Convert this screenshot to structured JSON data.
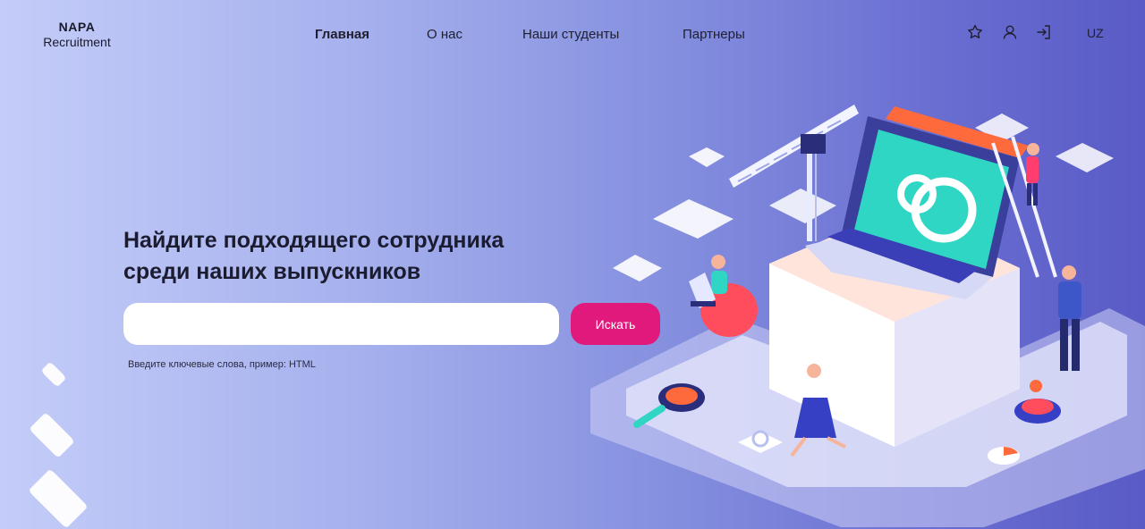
{
  "brand": {
    "line1": "NAPA",
    "line2": "Recruitment"
  },
  "nav": {
    "items": [
      {
        "label": "Главная",
        "active": true
      },
      {
        "label": "О нас",
        "active": false
      },
      {
        "label": "Наши студенты",
        "active": false
      },
      {
        "label": "Партнеры",
        "active": false
      }
    ]
  },
  "header_icons": [
    "star-icon",
    "user-icon",
    "login-icon"
  ],
  "language": "UZ",
  "hero": {
    "title_line1": "Найдите подходящего сотрудника",
    "title_line2": "среди наших выпускников"
  },
  "search": {
    "value": "",
    "placeholder": "",
    "button_label": "Искать",
    "hint": "Введите ключевые слова, пример: HTML"
  },
  "colors": {
    "accent": "#e2197c",
    "bg_left": "#c4cdf8",
    "bg_right": "#5a5bc6",
    "laptop_screen": "#2fd6c4",
    "keyboard": "#3a3fb8"
  }
}
